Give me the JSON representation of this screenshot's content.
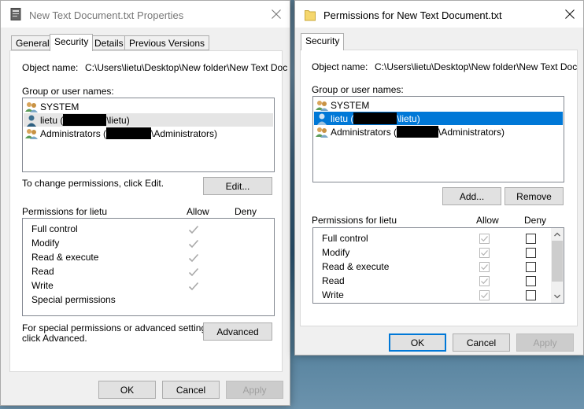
{
  "left": {
    "title": "New Text Document.txt Properties",
    "tabs": [
      "General",
      "Security",
      "Details",
      "Previous Versions"
    ],
    "object_name_label": "Object name:",
    "object_name_value": "C:\\Users\\lietu\\Desktop\\New folder\\New Text Doc",
    "group_label": "Group or user names:",
    "users": [
      {
        "name": "SYSTEM"
      },
      {
        "name_before": "lietu (",
        "name_after": "\\lietu)"
      },
      {
        "name_before": "Administrators (",
        "name_after": "\\Administrators)"
      }
    ],
    "change_text": "To change permissions, click Edit.",
    "edit_button": "Edit...",
    "permissions_for": "Permissions for lietu",
    "allow_header": "Allow",
    "deny_header": "Deny",
    "permissions": [
      {
        "name": "Full control",
        "allow": true
      },
      {
        "name": "Modify",
        "allow": true
      },
      {
        "name": "Read & execute",
        "allow": true
      },
      {
        "name": "Read",
        "allow": true
      },
      {
        "name": "Write",
        "allow": true
      },
      {
        "name": "Special permissions",
        "allow": false
      }
    ],
    "special_text_1": "For special permissions or advanced settings,",
    "special_text_2": "click Advanced.",
    "advanced_button": "Advanced",
    "ok": "OK",
    "cancel": "Cancel",
    "apply": "Apply"
  },
  "right": {
    "title": "Permissions for New Text Document.txt",
    "tab": "Security",
    "object_name_label": "Object name:",
    "object_name_value": "C:\\Users\\lietu\\Desktop\\New folder\\New Text Doc",
    "group_label": "Group or user names:",
    "users": [
      {
        "name": "SYSTEM"
      },
      {
        "name_before": "lietu (",
        "name_after": "\\lietu)"
      },
      {
        "name_before": "Administrators (",
        "name_after": "\\Administrators)"
      }
    ],
    "add_button": "Add...",
    "remove_button": "Remove",
    "permissions_for": "Permissions for lietu",
    "allow_header": "Allow",
    "deny_header": "Deny",
    "permissions": [
      {
        "name": "Full control"
      },
      {
        "name": "Modify"
      },
      {
        "name": "Read & execute"
      },
      {
        "name": "Read"
      },
      {
        "name": "Write"
      }
    ],
    "ok": "OK",
    "cancel": "Cancel",
    "apply": "Apply"
  },
  "colors": {
    "selection": "#0078d7",
    "accent": "#0078d7"
  }
}
